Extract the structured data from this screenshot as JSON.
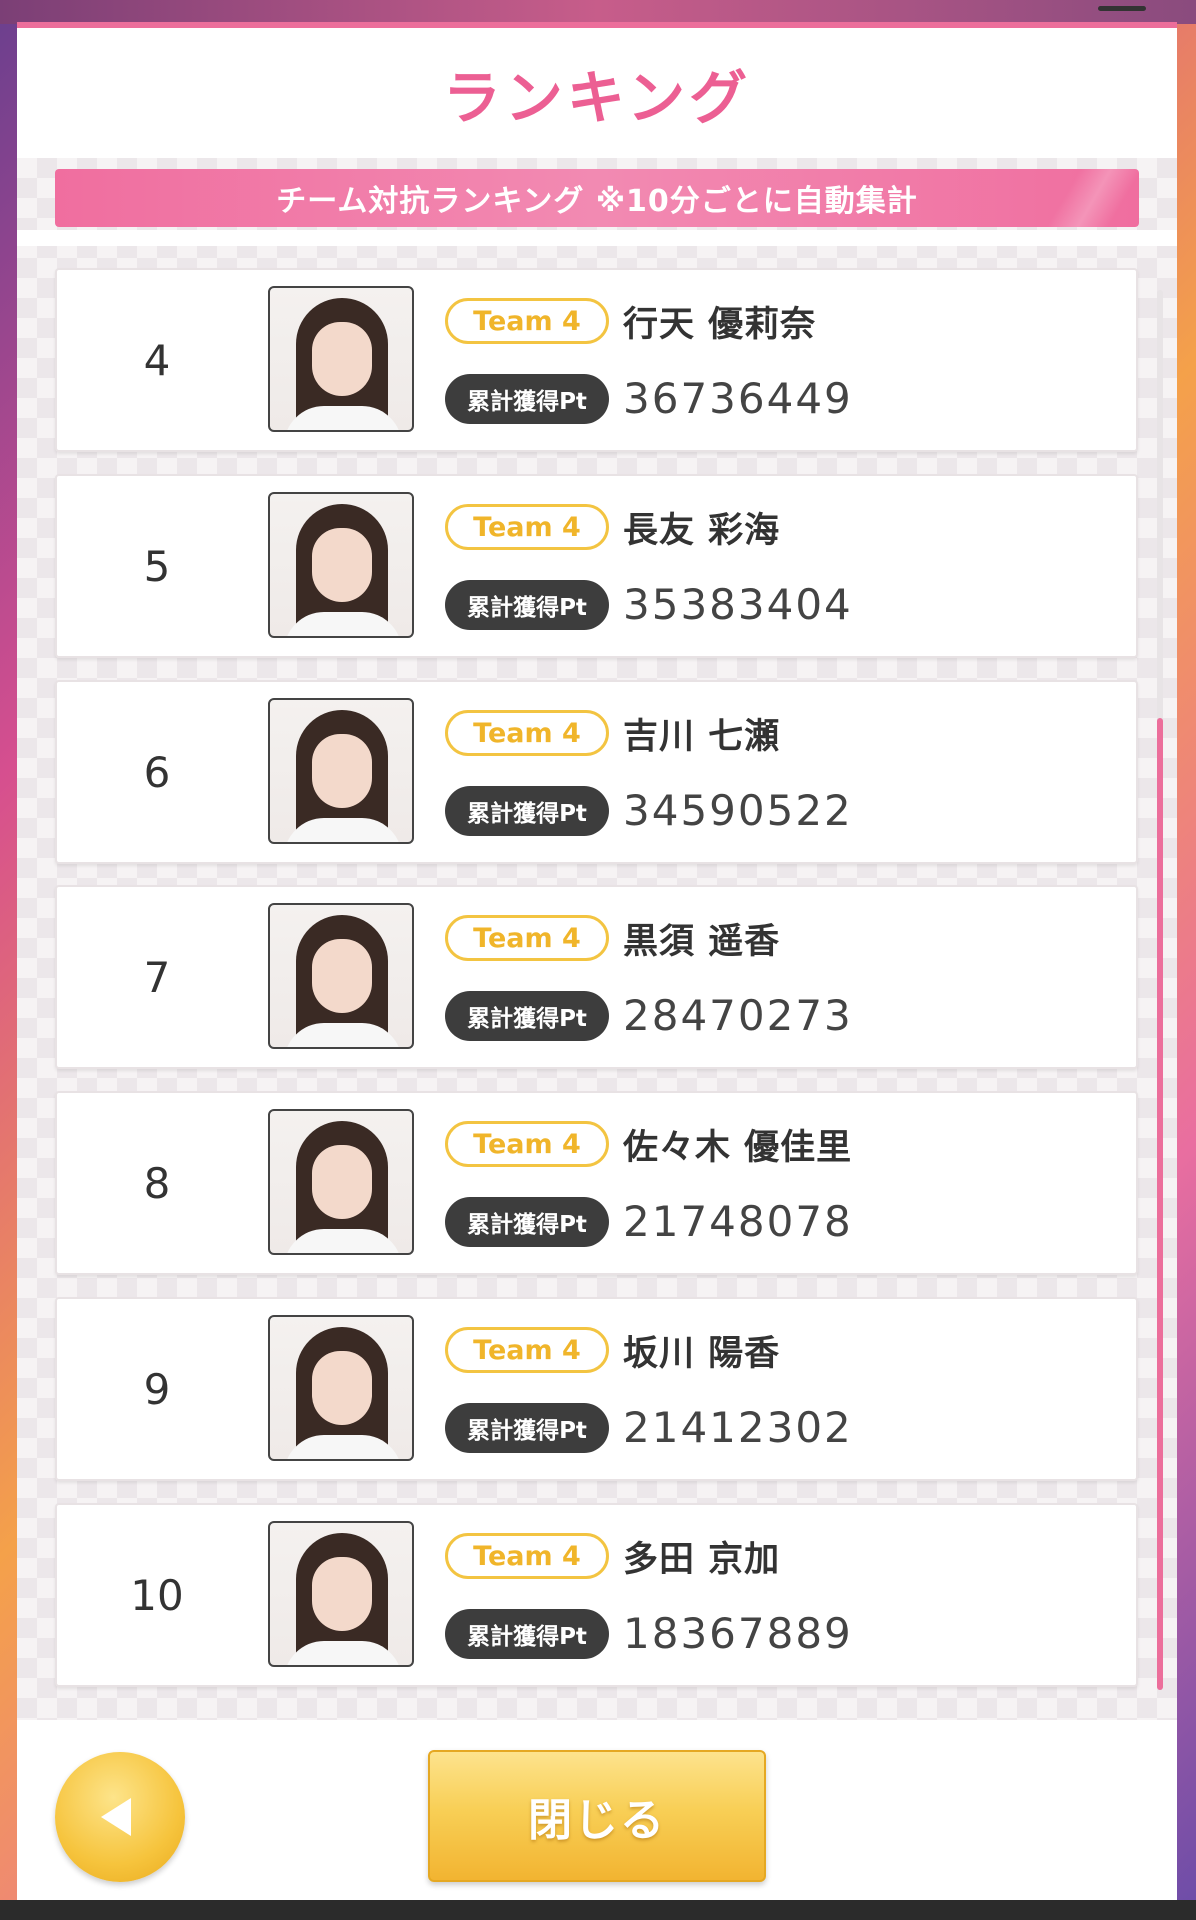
{
  "dialog": {
    "title": "ランキング",
    "banner": "チーム対抗ランキング ※10分ごとに自動集計"
  },
  "ranking": [
    {
      "rank": "4",
      "team": "Team 4",
      "name": "行天 優莉奈",
      "pt_label": "累計獲得Pt",
      "points": "36736449"
    },
    {
      "rank": "5",
      "team": "Team 4",
      "name": "長友 彩海",
      "pt_label": "累計獲得Pt",
      "points": "35383404"
    },
    {
      "rank": "6",
      "team": "Team 4",
      "name": "吉川 七瀬",
      "pt_label": "累計獲得Pt",
      "points": "34590522"
    },
    {
      "rank": "7",
      "team": "Team 4",
      "name": "黒須 遥香",
      "pt_label": "累計獲得Pt",
      "points": "28470273"
    },
    {
      "rank": "8",
      "team": "Team 4",
      "name": "佐々木 優佳里",
      "pt_label": "累計獲得Pt",
      "points": "21748078"
    },
    {
      "rank": "9",
      "team": "Team 4",
      "name": "坂川 陽香",
      "pt_label": "累計獲得Pt",
      "points": "21412302"
    },
    {
      "rank": "10",
      "team": "Team 4",
      "name": "多田 京加",
      "pt_label": "累計獲得Pt",
      "points": "18367889"
    }
  ],
  "footer": {
    "back_icon": "back-arrow-icon",
    "close_label": "閉じる"
  },
  "colors": {
    "accent_pink": "#ec5f93",
    "badge_gold": "#f3c441",
    "button_gold": "#f6c43d"
  }
}
